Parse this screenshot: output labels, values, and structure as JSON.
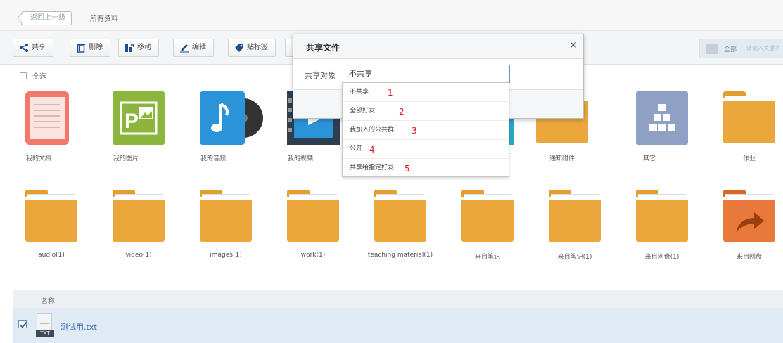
{
  "topbar": {
    "back_label": "返回上一级",
    "breadcrumb": "所有资料"
  },
  "toolbar": {
    "share": "共享",
    "delete": "删除",
    "move": "移动",
    "edit": "编辑",
    "tag": "贴标签",
    "filter_all": "全部",
    "search_hint": "请输入关键字"
  },
  "select_all": "全选",
  "tiles_row1": [
    "我的文档",
    "我的图片",
    "我的音频",
    "我的视频",
    "",
    "",
    "通知附件",
    "其它",
    "作业"
  ],
  "tiles_row2": [
    "audio(1)",
    "video(1)",
    "images(1)",
    "work(1)",
    "teaching material(1)",
    "来自笔记",
    "来自笔记(1)",
    "来自网盘(1)",
    "来自网盘"
  ],
  "list": {
    "col_name": "名称",
    "file_name": "测试用.txt",
    "file_ext": "TXT"
  },
  "dialog": {
    "title": "共享文件",
    "close": "✕",
    "target_label": "共享对象",
    "selected": "不共享",
    "options": [
      {
        "label": "不共享",
        "marker": "1"
      },
      {
        "label": "全部好友",
        "marker": "2"
      },
      {
        "label": "我加入的公共群",
        "marker": "3"
      },
      {
        "label": "公开",
        "marker": "4"
      },
      {
        "label": "共享给指定好友",
        "marker": "5"
      }
    ]
  },
  "colors": {
    "folder": "#eba73b",
    "accent": "#2d6cb3",
    "marker": "#e0141e"
  },
  "icons": [
    "share-icon",
    "trash-icon",
    "move-icon",
    "edit-icon",
    "tag-icon",
    "close-icon"
  ]
}
